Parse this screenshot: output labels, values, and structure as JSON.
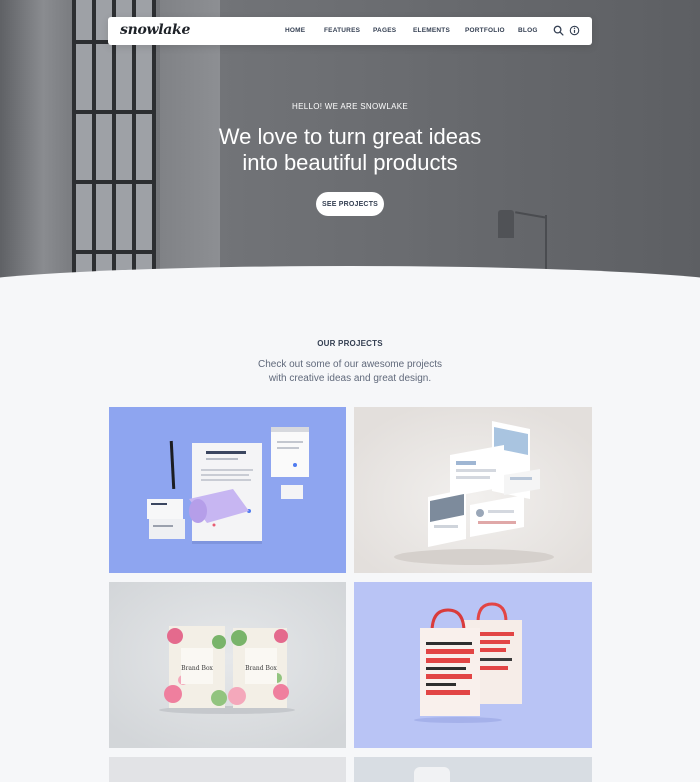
{
  "nav": {
    "logo": "snowlake",
    "links": [
      "HOME",
      "FEATURES",
      "PAGES",
      "ELEMENTS",
      "PORTFOLIO",
      "BLOG"
    ],
    "icons": [
      "search-icon",
      "info-icon"
    ]
  },
  "hero": {
    "kicker": "HELLO! WE ARE SNOWLAKE",
    "title_line1": "We love to turn great ideas",
    "title_line2": "into beautiful products",
    "button": "SEE PROJECTS"
  },
  "projects": {
    "kicker": "OUR PROJECTS",
    "lead_line1": "Check out some of our awesome projects",
    "lead_line2": "with creative ideas and great design.",
    "cards": [
      {
        "name": "stationery-mockup",
        "bg": "#8ea5f0"
      },
      {
        "name": "app-screens-mockup",
        "bg": "#ebe8e5"
      },
      {
        "name": "brand-box-mockup",
        "bg": "#dcdfe2"
      },
      {
        "name": "shopping-bag-mockup",
        "bg": "#b9c4f5"
      }
    ],
    "brand_box_text": "Brand Box",
    "bag_text": "SHOPPING PAPERBAG MOCKUP RESOURCE"
  },
  "colors": {
    "text_dark": "#343f52",
    "text_muted": "#60697b",
    "page_bg": "#f6f7f9"
  }
}
